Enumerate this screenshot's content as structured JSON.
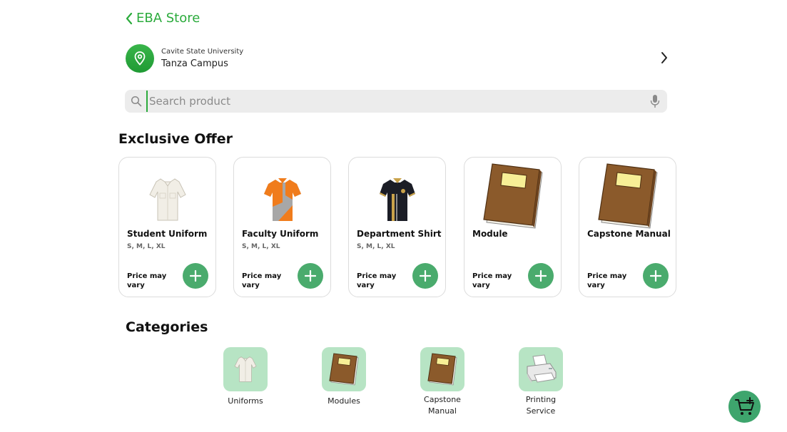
{
  "header": {
    "back_label": "EBA Store"
  },
  "location": {
    "university": "Cavite State University",
    "campus": "Tanza Campus"
  },
  "search": {
    "placeholder": "Search product"
  },
  "offer": {
    "title": "Exclusive Offer",
    "products": [
      {
        "name": "Student Uniform",
        "sizes": "S, M, L, XL",
        "price": "Price may vary",
        "icon": "white-shirt-icon"
      },
      {
        "name": "Faculty Uniform",
        "sizes": "S, M, L, XL",
        "price": "Price may vary",
        "icon": "orange-polo-icon"
      },
      {
        "name": "Department  Shirt",
        "sizes": "S, M, L, XL",
        "price": "Price may vary",
        "icon": "black-polo-icon"
      },
      {
        "name": "Module",
        "sizes": "",
        "price": "Price may vary",
        "icon": "book-icon"
      },
      {
        "name": "Capstone Manual",
        "sizes": "",
        "price": "Price may vary",
        "icon": "book-icon"
      }
    ]
  },
  "categories": {
    "title": "Categories",
    "items": [
      {
        "label": "Uniforms",
        "icon": "shirt-icon"
      },
      {
        "label": "Modules",
        "icon": "book-icon"
      },
      {
        "label": "Capstone Manual",
        "icon": "book-icon"
      },
      {
        "label": "Printing Service",
        "icon": "printer-icon"
      }
    ]
  },
  "colors": {
    "accent": "#2bab3c",
    "button": "#4aab6d",
    "category_tile": "#b7e4c4",
    "cart": "#3ea56d"
  }
}
